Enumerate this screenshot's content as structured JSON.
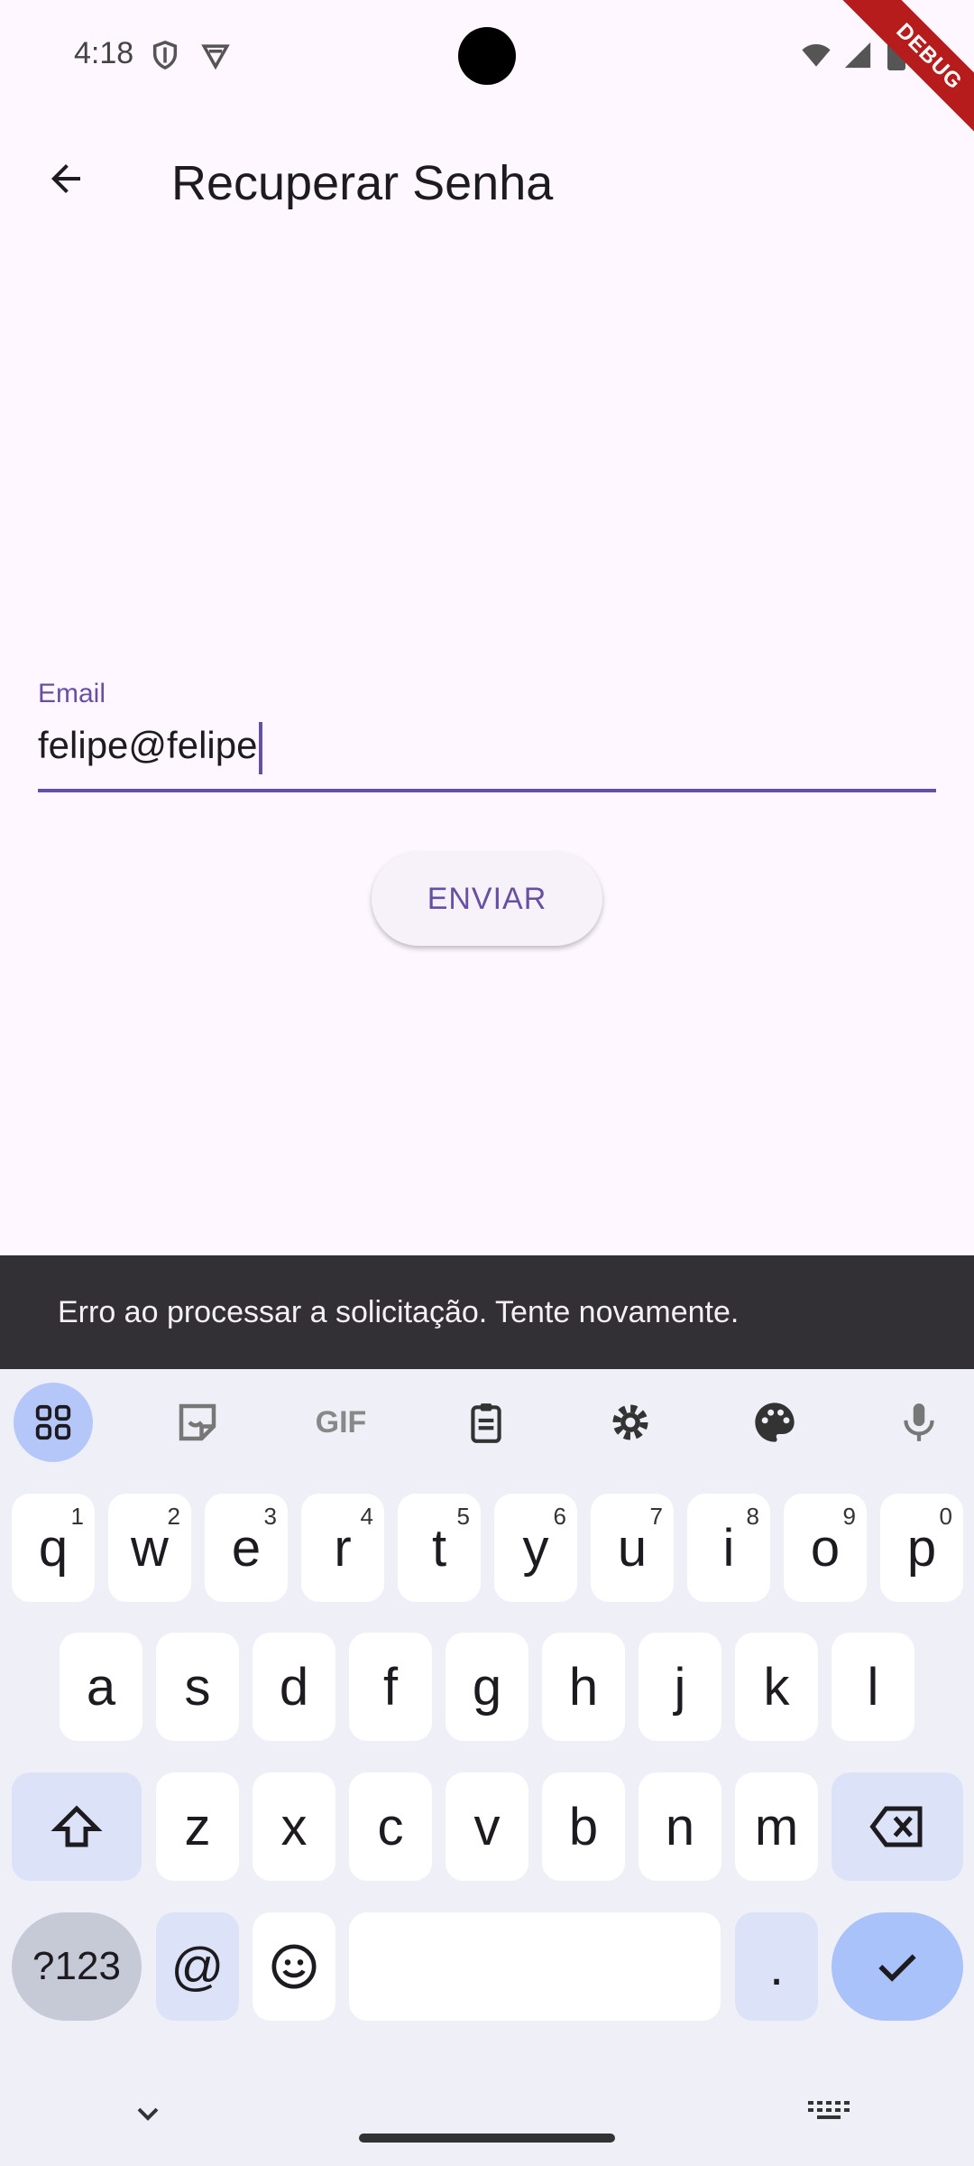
{
  "status_bar": {
    "time": "4:18",
    "icons": [
      "shield-icon",
      "vpn-shield-icon",
      "wifi-icon",
      "signal-icon",
      "battery-icon"
    ]
  },
  "debug_banner": "DEBUG",
  "app_bar": {
    "back_icon": "arrow-back-icon",
    "title": "Recuperar Senha"
  },
  "form": {
    "email_label": "Email",
    "email_value": "felipe@felipe",
    "submit_label": "ENVIAR"
  },
  "snackbar": {
    "message": "Erro ao processar a solicitação. Tente novamente."
  },
  "keyboard": {
    "toolbar": [
      "apps-grid-icon",
      "sticker-icon",
      "gif-icon",
      "clipboard-icon",
      "settings-icon",
      "palette-icon",
      "mic-icon"
    ],
    "gif_label": "GIF",
    "row1": [
      {
        "k": "q",
        "n": "1"
      },
      {
        "k": "w",
        "n": "2"
      },
      {
        "k": "e",
        "n": "3"
      },
      {
        "k": "r",
        "n": "4"
      },
      {
        "k": "t",
        "n": "5"
      },
      {
        "k": "y",
        "n": "6"
      },
      {
        "k": "u",
        "n": "7"
      },
      {
        "k": "i",
        "n": "8"
      },
      {
        "k": "o",
        "n": "9"
      },
      {
        "k": "p",
        "n": "0"
      }
    ],
    "row2": [
      "a",
      "s",
      "d",
      "f",
      "g",
      "h",
      "j",
      "k",
      "l"
    ],
    "row3": [
      "z",
      "x",
      "c",
      "v",
      "b",
      "n",
      "m"
    ],
    "sym_label": "?123",
    "at_label": "@",
    "period_label": ".",
    "colors": {
      "accent": "#6750A4",
      "enter": "#A9C2F9",
      "modifier": "#DCE3F9"
    }
  }
}
